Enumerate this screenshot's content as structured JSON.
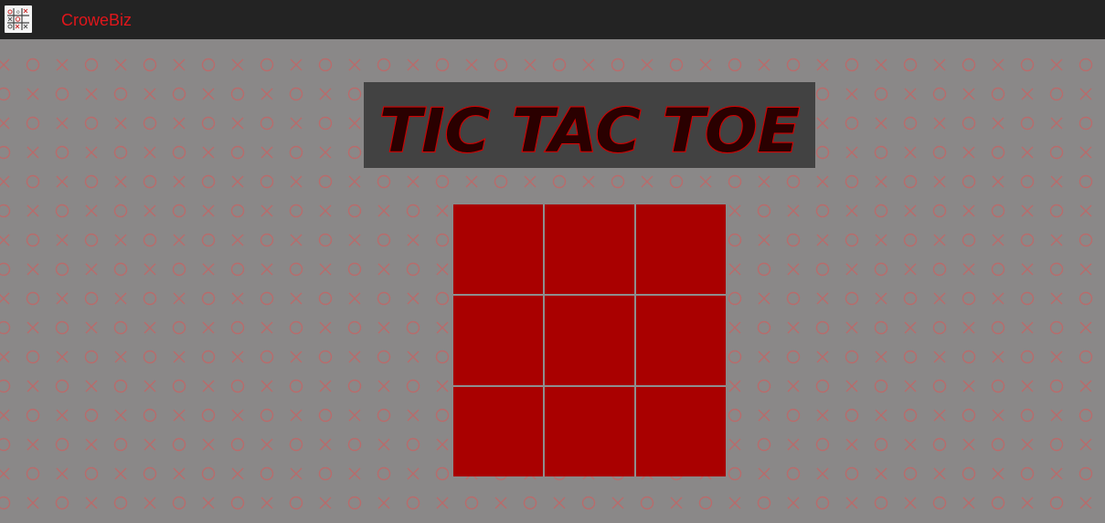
{
  "navbar": {
    "brand": "CroweBiz",
    "logo_icon": "tic-tac-toe-logo-icon"
  },
  "title": "TIC TAC TOE",
  "colors": {
    "navbar_bg": "#232323",
    "brand": "#e0161b",
    "page_bg": "#8a8888",
    "pattern": "#b96b6b",
    "banner_bg": "#424242",
    "title_stroke": "#d00000",
    "cell": "#a90000"
  },
  "board": {
    "cells": [
      "",
      "",
      "",
      "",
      "",
      "",
      "",
      "",
      ""
    ]
  }
}
